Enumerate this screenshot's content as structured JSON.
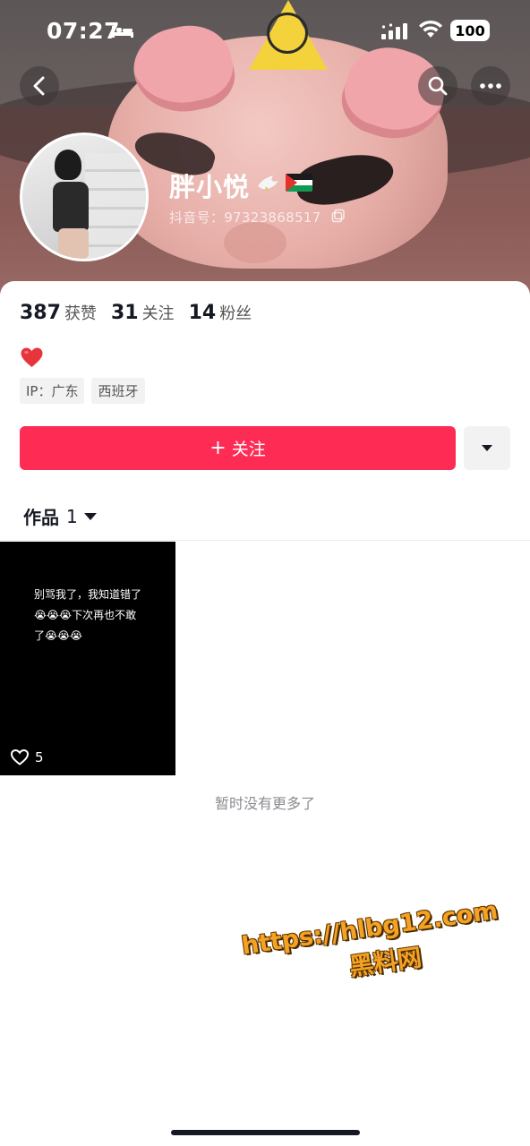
{
  "status_bar": {
    "time": "07:27",
    "battery": "100"
  },
  "profile": {
    "name": "胖小悦",
    "name_emojis": [
      "dove-icon",
      "palestine-flag-icon"
    ],
    "douyin_id": "抖音号：97323868517",
    "stats": [
      {
        "value": "387",
        "label": "获赞"
      },
      {
        "value": "31",
        "label": "关注"
      },
      {
        "value": "14",
        "label": "粉丝"
      }
    ],
    "bio_emoji": "red-heart-icon",
    "tags": [
      "IP：广东",
      "西班牙"
    ]
  },
  "actions": {
    "follow_plus": "+",
    "follow_label": "关注"
  },
  "works": {
    "tab_label": "作品",
    "tab_count": "1",
    "videos": [
      {
        "caption_line1": "别骂我了，我知道错了",
        "caption_line2": "😭😭😭下次再也不敢",
        "caption_line3": "了😭😭😭",
        "likes": "5"
      }
    ],
    "end_text": "暂时没有更多了"
  },
  "watermark": {
    "url": "https://hlbg12.com",
    "name": "黑料网"
  },
  "colors": {
    "accent": "#fe2c55",
    "text_primary": "#161823",
    "text_secondary": "#8a8b91",
    "tag_bg": "#f2f2f3",
    "watermark": "#f4a225"
  }
}
